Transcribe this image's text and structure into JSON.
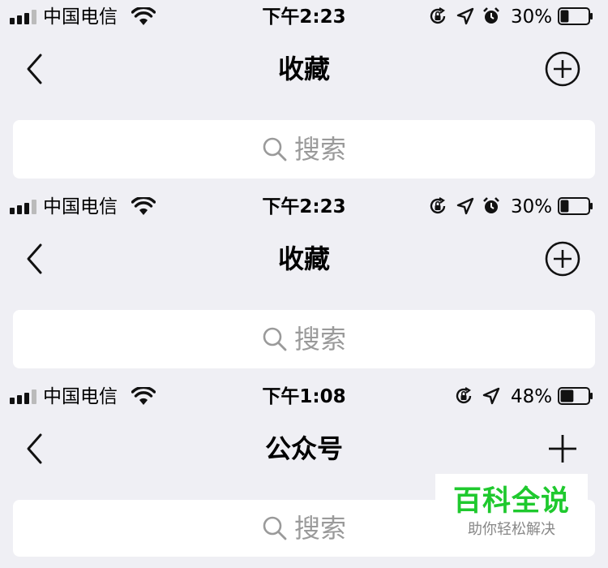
{
  "screens": [
    {
      "carrier": "中国电信",
      "time": "下午2:23",
      "battery_percent": "30%",
      "battery_level": 0.3,
      "show_alarm": true,
      "title": "收藏",
      "right_button": "circle-plus-icon",
      "search_placeholder": "搜索"
    },
    {
      "carrier": "中国电信",
      "time": "下午2:23",
      "battery_percent": "30%",
      "battery_level": 0.3,
      "show_alarm": true,
      "title": "收藏",
      "right_button": "circle-plus-icon",
      "search_placeholder": "搜索"
    },
    {
      "carrier": "中国电信",
      "time": "下午1:08",
      "battery_percent": "48%",
      "battery_level": 0.48,
      "show_alarm": false,
      "title": "公众号",
      "right_button": "plus-icon",
      "search_placeholder": "搜索"
    }
  ],
  "watermark": {
    "title": "百科全说",
    "subtitle": "助你轻松解决"
  }
}
